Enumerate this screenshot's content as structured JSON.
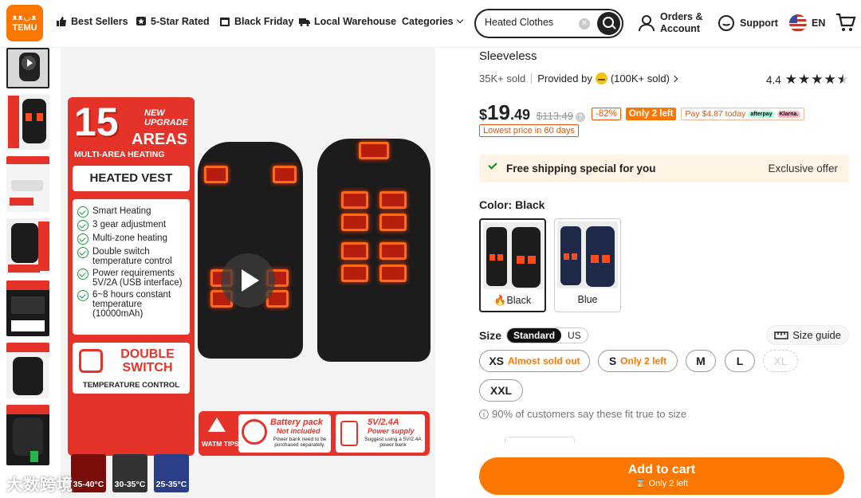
{
  "header": {
    "logo_top": "ᴥᴥ◡ᴥ",
    "logo": "TEMU",
    "nav": [
      "Best Sellers",
      "5-Star Rated",
      "Black Friday",
      "Local Warehouse",
      "Categories"
    ],
    "search_value": "Heated Clothes",
    "account_line1": "Orders &",
    "account_line2": "Account",
    "support": "Support",
    "lang": "EN"
  },
  "image": {
    "panel_number": "15",
    "panel_new": "NEW",
    "panel_upgrade": "UPGRADE",
    "panel_areas": "AREAS",
    "panel_multi": "MULTI-AREA HEATING",
    "panel_product": "HEATED VEST",
    "features": [
      "Smart Heating",
      "3 gear adjustment",
      "Multi-zone heating",
      "Double switch temperature control",
      "Power requirements 5V/2A (USB interface)",
      "6~8 hours constant temperature (10000mAh)"
    ],
    "double_switch": "DOUBLE SWITCH",
    "temp_control": "TEMPERATURE CONTROL",
    "temps": [
      "35-40°C",
      "30-35°C",
      "25-35°C"
    ],
    "warm_tips": "WATM TIPS",
    "battery_title": "Battery pack",
    "battery_not": "Not included",
    "battery_note": "Power bank need to be purchased separately.",
    "power_title": "5V/2.4A",
    "power_sub": "Power supply",
    "power_note": "Suggest using a 5V/2.4A power bank",
    "watermark": "大数跨境"
  },
  "product": {
    "title": "Sleeveless",
    "sold": "35K+ sold",
    "provided_by": "Provided by",
    "provider_sold": "(100K+ sold)",
    "rating": "4.4",
    "price_currency": "$",
    "price_int": "19",
    "price_dec": ".49",
    "price_orig": "$113.49",
    "discount": "-82%",
    "stock_badge": "Only 2 left",
    "pay_today": "Pay $4.87 today",
    "pay_brand1": "afterpay",
    "pay_brand2": "Klarna.",
    "lowest": "Lowest price in 60 days",
    "shipping": "Free shipping special for you",
    "exclusive": "Exclusive offer",
    "color_label": "Color: Black",
    "colors": [
      "Black",
      "Blue"
    ],
    "size_label": "Size",
    "size_system": [
      "Standard",
      "US"
    ],
    "size_guide": "Size guide",
    "sizes": [
      {
        "label": "XS",
        "note": "Almost sold out"
      },
      {
        "label": "S",
        "note": "Only 2 left"
      },
      {
        "label": "M",
        "note": ""
      },
      {
        "label": "L",
        "note": ""
      },
      {
        "label": "XL",
        "note": ""
      },
      {
        "label": "XXL",
        "note": ""
      }
    ],
    "fit_note": "90% of customers say these fit true to size",
    "add_to_cart": "Add to cart",
    "add_to_cart_sub": "Only 2 left"
  },
  "colors": {
    "brand": "#fb7701",
    "heat": "#e6332a",
    "ship_bg": "#fff3e6"
  }
}
